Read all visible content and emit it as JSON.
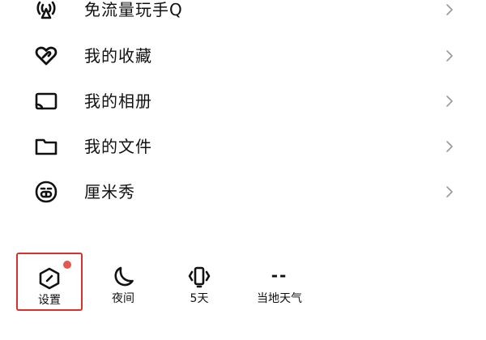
{
  "menu": {
    "items": [
      {
        "label": "免流量玩手Q",
        "icon": "broadcast-icon"
      },
      {
        "label": "我的收藏",
        "icon": "heart-link-icon"
      },
      {
        "label": "我的相册",
        "icon": "cast-screen-icon"
      },
      {
        "label": "我的文件",
        "icon": "folder-icon"
      },
      {
        "label": "厘米秀",
        "icon": "smile-face-icon"
      }
    ]
  },
  "bottom": {
    "settings": {
      "label": "设置",
      "icon": "settings-hexagon-icon",
      "has_badge": true
    },
    "night": {
      "label": "夜间",
      "icon": "moon-icon"
    },
    "days": {
      "label": "5天",
      "icon": "phone-vibrate-icon"
    },
    "weather": {
      "label": "当地天气",
      "value": "--"
    }
  },
  "colors": {
    "badge": "#e5574f",
    "highlight_border": "#d9302c",
    "text": "#111111",
    "chevron": "#9a9a9a"
  }
}
